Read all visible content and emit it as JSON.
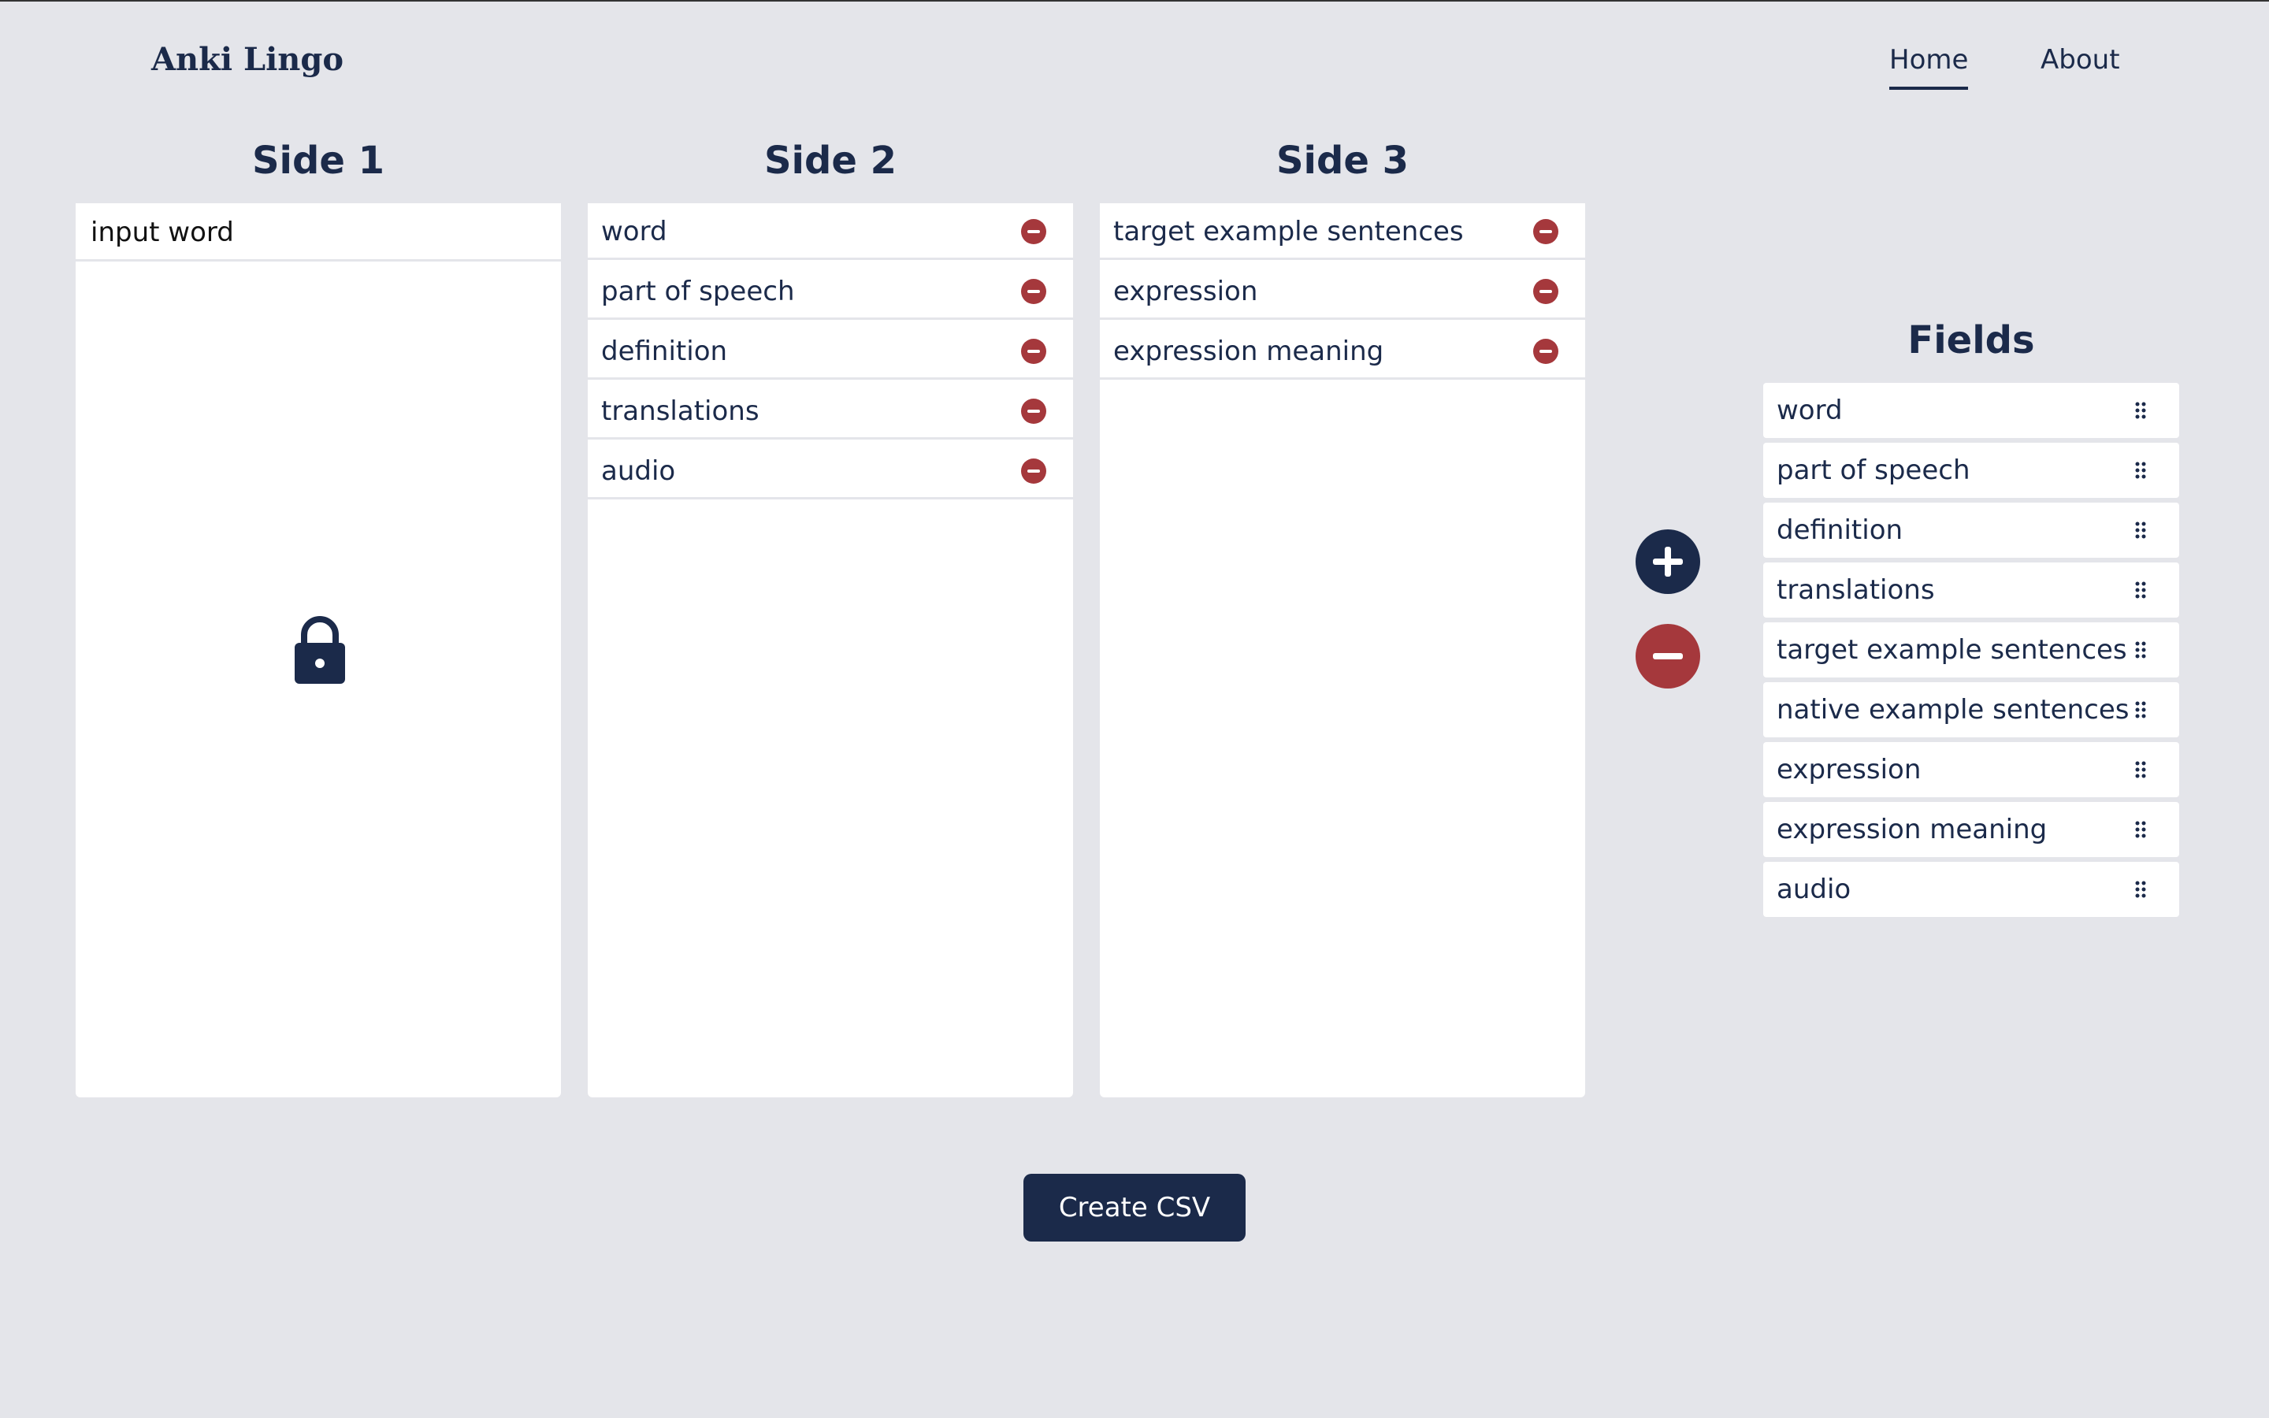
{
  "brand": "Anki Lingo",
  "nav": {
    "home": "Home",
    "about": "About"
  },
  "columns": {
    "side1": {
      "title": "Side 1",
      "input_value": "input word"
    },
    "side2": {
      "title": "Side 2",
      "items": [
        "word",
        "part of speech",
        "definition",
        "translations",
        "audio"
      ]
    },
    "side3": {
      "title": "Side 3",
      "items": [
        "target example sentences",
        "expression",
        "expression meaning"
      ]
    }
  },
  "fields": {
    "title": "Fields",
    "items": [
      "word",
      "part of speech",
      "definition",
      "translations",
      "target example sentences",
      "native example sentences",
      "expression",
      "expression meaning",
      "audio"
    ]
  },
  "actions": {
    "create_csv": "Create CSV"
  },
  "icons": {
    "lock": "lock-icon",
    "remove": "minus-circle-icon",
    "add_side": "plus-circle-icon",
    "remove_side": "minus-circle-icon",
    "drag": "drag-handle-icon"
  },
  "colors": {
    "background": "#e4e5ea",
    "primary": "#1b2a4a",
    "danger": "#a5383c",
    "surface": "#ffffff"
  }
}
